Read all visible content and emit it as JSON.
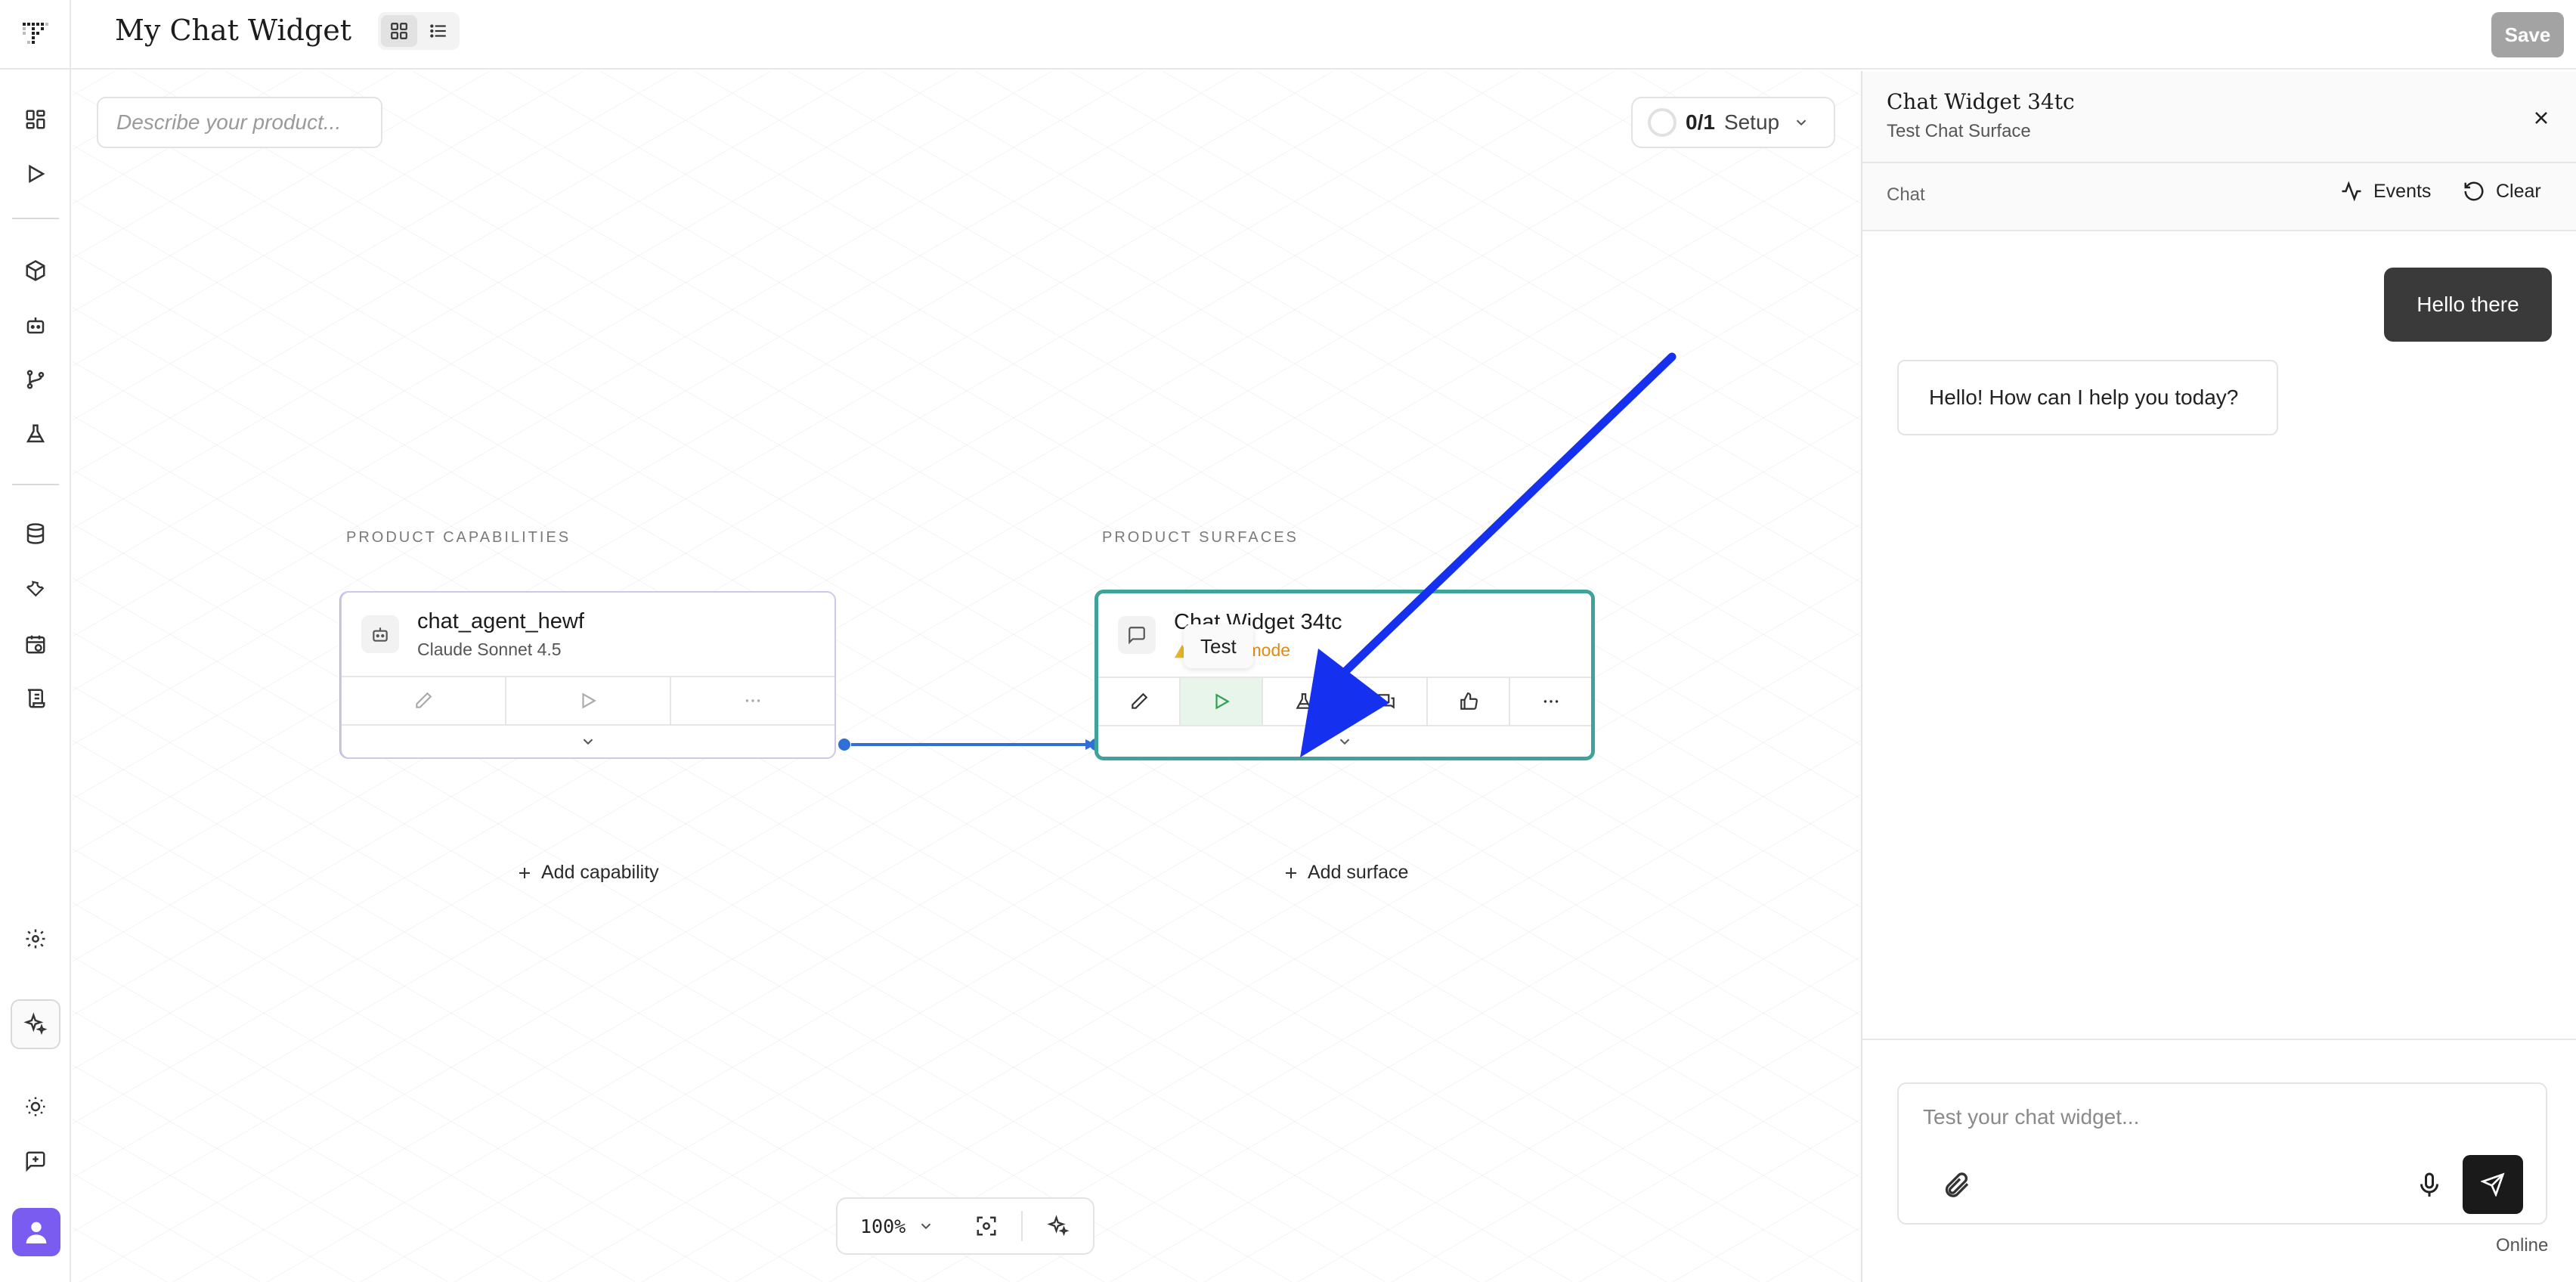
{
  "app": {
    "title": "My Chat Widget",
    "save_label": "Save"
  },
  "canvas": {
    "describe_placeholder": "Describe your product...",
    "setup": {
      "count": "0/1",
      "label": "Setup"
    },
    "capabilities_label": "PRODUCT CAPABILITIES",
    "surfaces_label": "PRODUCT SURFACES",
    "capability_card": {
      "title": "chat_agent_hewf",
      "subtitle": "Claude Sonnet 4.5"
    },
    "surface_card": {
      "title": "Chat Widget 34tc",
      "subtitle": "Setup mode"
    },
    "add_capability": "Add capability",
    "add_surface": "Add surface",
    "tooltip": "Test",
    "zoom": "100%"
  },
  "panel": {
    "title": "Chat Widget 34tc",
    "subtitle": "Test Chat Surface",
    "tab": "Chat",
    "events_label": "Events",
    "clear_label": "Clear",
    "messages": [
      {
        "role": "user",
        "text": "Hello there"
      },
      {
        "role": "assistant",
        "text": "Hello! How can I help you today?"
      }
    ],
    "composer_placeholder": "Test your chat widget...",
    "status": "Online"
  },
  "colors": {
    "surface_border": "#3fa39b",
    "connector": "#2f6fd6",
    "annotation_arrow": "#1630f0",
    "setup_warning": "#e08b14",
    "avatar": "#7b5cf0"
  }
}
